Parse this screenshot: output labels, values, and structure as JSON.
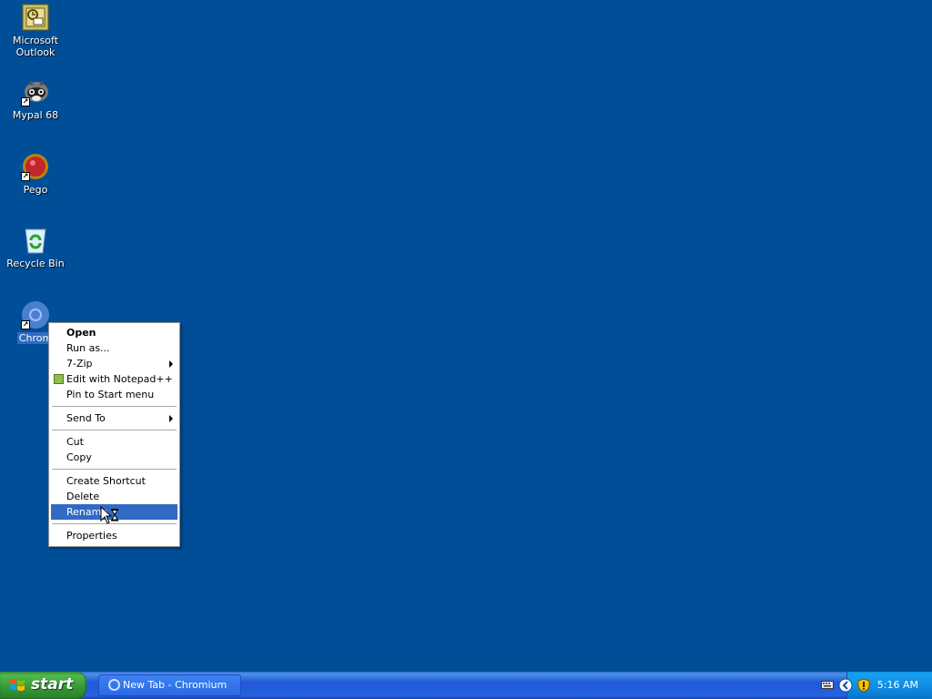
{
  "desktop": {
    "icons": [
      {
        "label_line1": "Microsoft",
        "label_line2": "Outlook",
        "icon": "outlook-icon",
        "shortcut": false
      },
      {
        "label_line1": "Mypal 68",
        "icon": "mypal-icon",
        "shortcut": true
      },
      {
        "label_line1": "Pego",
        "icon": "pego-icon",
        "shortcut": true
      },
      {
        "label_line1": "Recycle Bin",
        "icon": "recycle-bin-icon",
        "shortcut": false
      },
      {
        "label_line1": "Chrom",
        "icon": "chromium-icon",
        "shortcut": true,
        "selected": true
      }
    ]
  },
  "context_menu": {
    "items": [
      {
        "label": "Open",
        "bold": true
      },
      {
        "label": "Run as..."
      },
      {
        "label": "7-Zip",
        "submenu": true
      },
      {
        "label": "Edit with Notepad++",
        "icon": "notepadpp-icon"
      },
      {
        "label": "Pin to Start menu"
      },
      {
        "label": "Send To",
        "submenu": true
      },
      {
        "label": "Cut"
      },
      {
        "label": "Copy"
      },
      {
        "label": "Create Shortcut"
      },
      {
        "label": "Delete"
      },
      {
        "label": "Rename",
        "highlighted": true
      },
      {
        "label": "Properties"
      }
    ]
  },
  "taskbar": {
    "start_label": "start",
    "task_label": "New Tab - Chromium",
    "clock": "5:16 AM"
  },
  "colors": {
    "desktop_bg": "#004e98",
    "menu_highlight": "#316ac5",
    "taskbar_blue": "#245edb",
    "start_green": "#3c9a3c"
  }
}
